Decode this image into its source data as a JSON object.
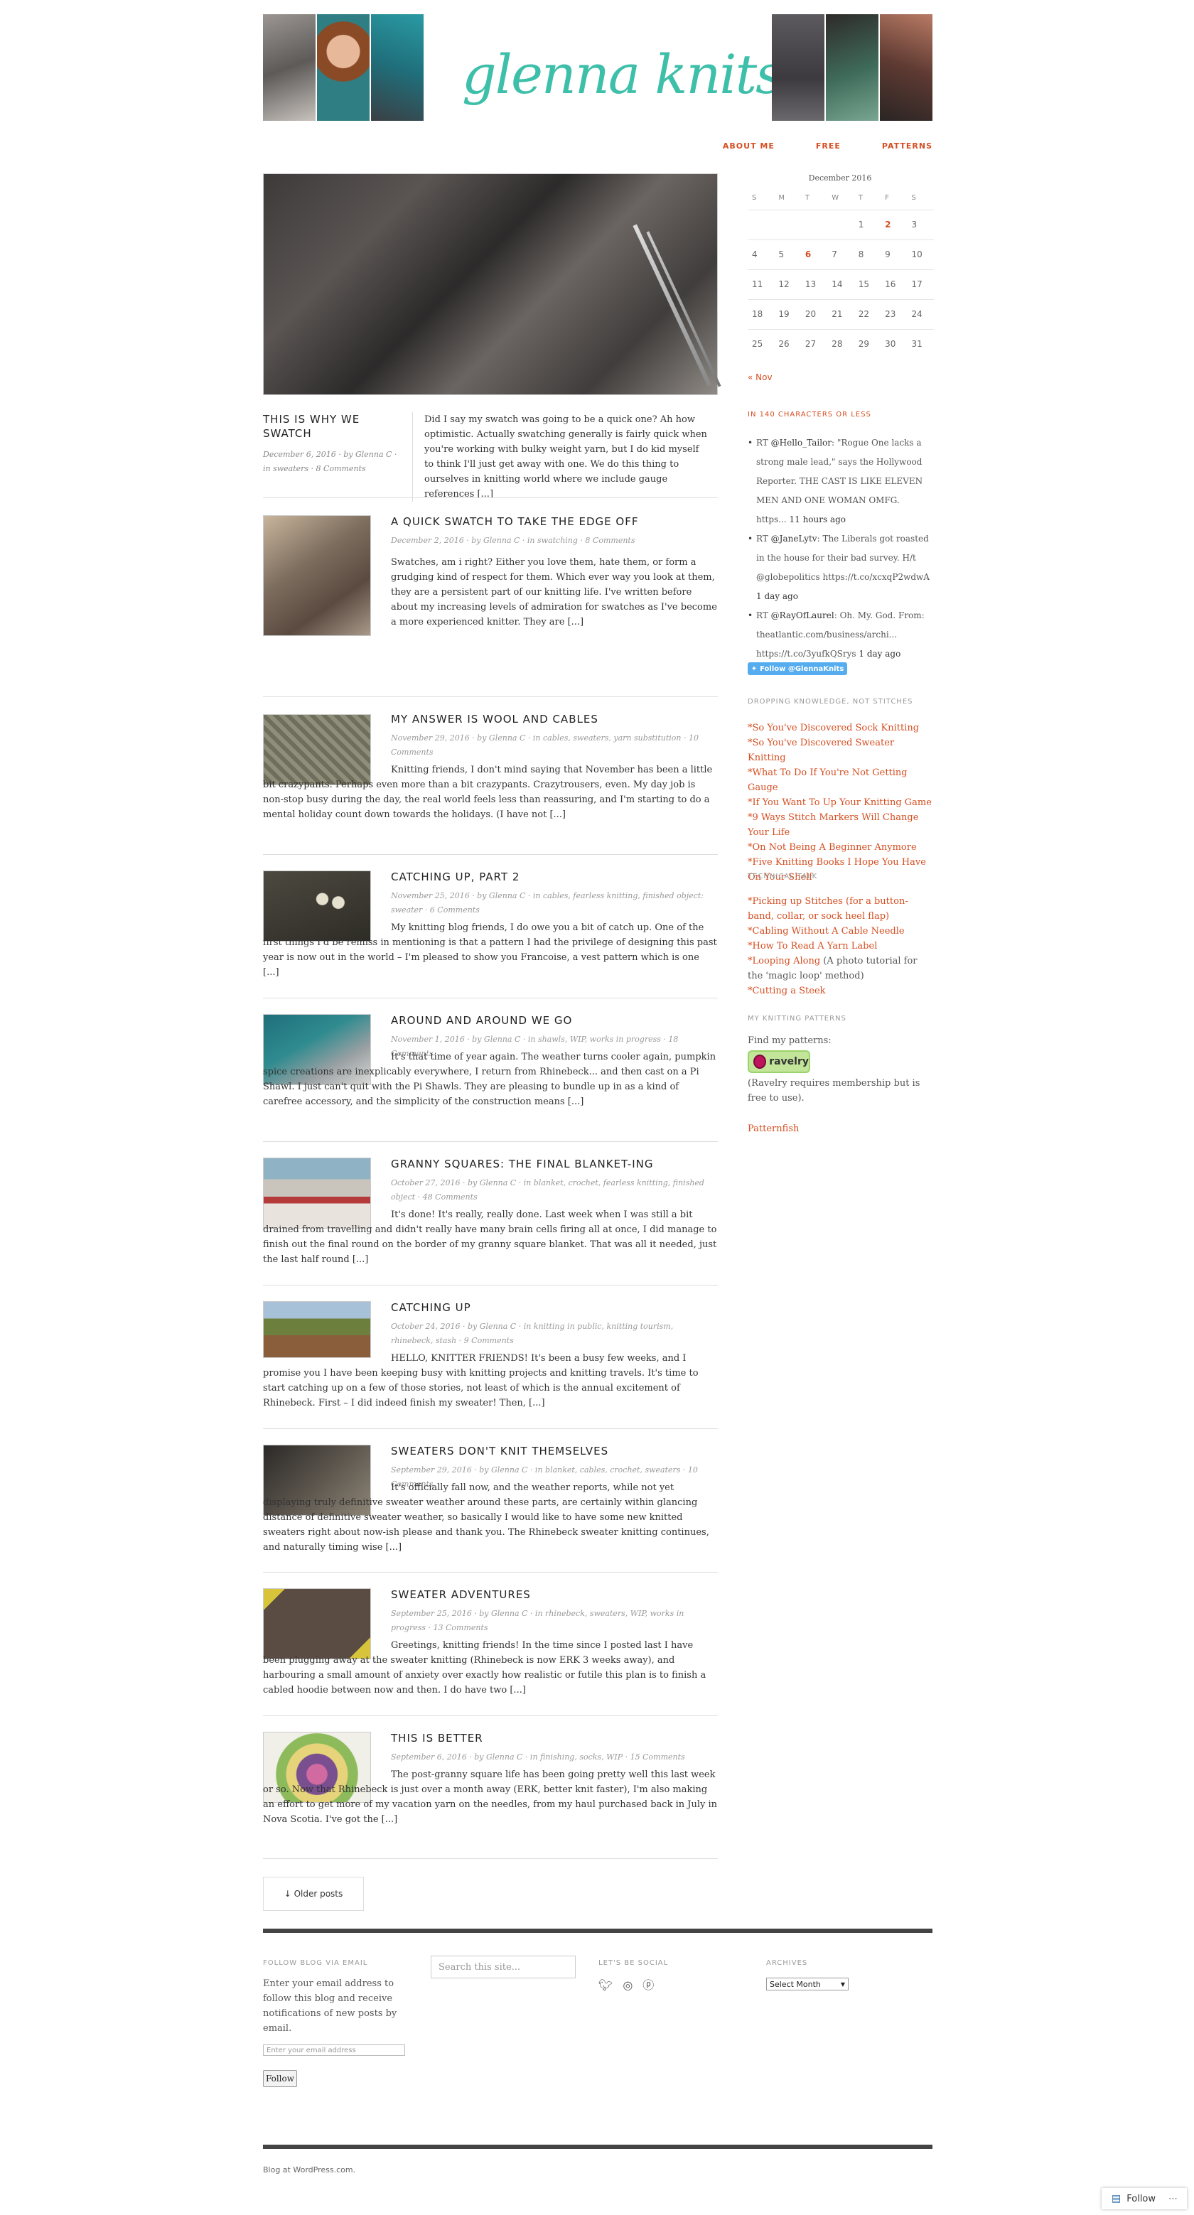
{
  "header": {
    "logo": "glenna knits"
  },
  "nav": [
    {
      "label": "ABOUT ME"
    },
    {
      "label": "FREE"
    },
    {
      "label": "PATTERNS"
    }
  ],
  "featured": {
    "title": "THIS IS WHY WE SWATCH",
    "meta": "December 6, 2016 · by Glenna C · in sweaters · 8 Comments",
    "excerpt": "Did I say my swatch was going to be a quick one? Ah how optimistic. Actually swatching generally is fairly quick when you're working with bulky weight yarn, but I do kid myself to think I'll just get away with one. We do this thing to ourselves in knitting world where we include gauge references [...]"
  },
  "posts": [
    {
      "title": "A QUICK SWATCH TO TAKE THE EDGE OFF",
      "meta": "December 2, 2016 · by Glenna C · in swatching · 8 Comments",
      "excerpt": "Swatches, am i right? Either you love them, hate them, or form a grudging kind of respect for them. Which ever way you look at them, they are a persistent part of our knitting life. I've written before about my increasing levels of admiration for swatches as I've become a more experienced knitter. They are [...]"
    },
    {
      "title": "MY ANSWER IS WOOL AND CABLES",
      "meta": "November 29, 2016 · by Glenna C · in cables, sweaters, yarn substitution · 10 Comments",
      "excerpt": "Knitting friends, I don't mind saying that November has been a little bit crazypants. Perhaps even more than a bit crazypants. Crazytrousers, even. My day job is non-stop busy during the day, the real world feels less than reassuring, and I'm starting to do a mental holiday count down towards the holidays. (I have not [...]"
    },
    {
      "title": "CATCHING UP, PART 2",
      "meta": "November 25, 2016 · by Glenna C · in cables, fearless knitting, finished object: sweater · 6 Comments",
      "excerpt": "My knitting blog friends, I do owe you a bit of catch up. One of the first things I'd be remiss in mentioning is that a pattern I had the privilege of designing this past year is now out in the world – I'm pleased to show you Francoise, a vest pattern which is one [...]"
    },
    {
      "title": "AROUND AND AROUND WE GO",
      "meta": "November 1, 2016 · by Glenna C · in shawls, WIP, works in progress · 18 Comments",
      "excerpt": "It's that time of year again. The weather turns cooler again, pumpkin spice creations are inexplicably everywhere, I return from Rhinebeck... and then cast on a Pi Shawl. I just can't quit with the Pi Shawls. They are pleasing to bundle up in as a kind of carefree accessory, and the simplicity of the construction means [...]"
    },
    {
      "title": "GRANNY SQUARES: THE FINAL BLANKET-ING",
      "meta": "October 27, 2016 · by Glenna C · in blanket, crochet, fearless knitting, finished object · 48 Comments",
      "excerpt": "It's done! It's really, really done. Last week when I was still a bit drained from travelling and didn't really have many brain cells firing all at once, I did manage to finish out the final round on the border of my granny square blanket. That was all it needed, just the last half round [...]"
    },
    {
      "title": "CATCHING UP",
      "meta": "October 24, 2016 · by Glenna C · in knitting in public, knitting tourism, rhinebeck, stash · 9 Comments",
      "excerpt": "HELLO, KNITTER FRIENDS! It's been a busy few weeks, and I promise you I have been keeping busy with knitting projects and knitting travels. It's time to start catching up on a few of those stories, not least of which is the annual excitement of Rhinebeck. First – I did indeed finish my sweater! Then, [...]"
    },
    {
      "title": "SWEATERS DON'T KNIT THEMSELVES",
      "meta": "September 29, 2016 · by Glenna C · in blanket, cables, crochet, sweaters · 10 Comments",
      "excerpt": "It's officially fall now, and the weather reports, while not yet displaying truly definitive sweater weather around these parts, are certainly within glancing distance of definitive sweater weather, so basically I would like to have some new knitted sweaters right about now-ish please and thank you. The Rhinebeck sweater knitting continues, and naturally timing wise [...]"
    },
    {
      "title": "SWEATER ADVENTURES",
      "meta": "September 25, 2016 · by Glenna C · in rhinebeck, sweaters, WIP, works in progress · 13 Comments",
      "excerpt": "Greetings, knitting friends! In the time since I posted last I have been plugging away at the sweater knitting (Rhinebeck is now ERK 3 weeks away), and harbouring a small amount of anxiety over exactly how realistic or futile this plan is to finish a cabled hoodie between now and then. I do have two [...]"
    },
    {
      "title": "THIS IS BETTER",
      "meta": "September 6, 2016 · by Glenna C · in finishing, socks, WIP · 15 Comments",
      "excerpt": "The post-granny square life has been going pretty well this last week or so. Now that Rhinebeck is just over a month away (ERK, better knit faster), I'm also making an effort to get more of my vacation yarn on the needles, from my haul purchased back in July in Nova Scotia. I've got the [...]"
    }
  ],
  "older_posts": "↓  Older posts",
  "calendar": {
    "caption": "December 2016",
    "days": [
      "S",
      "M",
      "T",
      "W",
      "T",
      "F",
      "S"
    ],
    "weeks": [
      [
        "",
        "",
        "",
        "",
        "1",
        "2",
        "3"
      ],
      [
        "4",
        "5",
        "6",
        "7",
        "8",
        "9",
        "10"
      ],
      [
        "11",
        "12",
        "13",
        "14",
        "15",
        "16",
        "17"
      ],
      [
        "18",
        "19",
        "20",
        "21",
        "22",
        "23",
        "24"
      ],
      [
        "25",
        "26",
        "27",
        "28",
        "29",
        "30",
        "31"
      ]
    ],
    "linked_days": [
      "2",
      "6"
    ],
    "prev": "« Nov"
  },
  "twitter": {
    "title": "IN 140 CHARACTERS OR LESS",
    "tweets": [
      {
        "prefix": "RT ",
        "handle": "@Hello_Tailor",
        "text": ": \"Rogue One lacks a strong male lead,\" says the Hollywood Reporter. THE CAST IS LIKE ELEVEN MEN AND ONE WOMAN OMFG. https...",
        "time": "11 hours ago"
      },
      {
        "prefix": "RT ",
        "handle": "@JaneLytv",
        "text": ": The Liberals got roasted in the house for their bad survey. H/t @globepolitics https://t.co/xcxqP2wdwA",
        "time": "1 day ago"
      },
      {
        "prefix": "RT ",
        "handle": "@RayOfLaurel",
        "text": ": Oh. My. God. From: theatlantic.com/business/archi... https://t.co/3yufkQSrys",
        "time": "1 day ago"
      }
    ],
    "follow": "Follow @GlennaKnits"
  },
  "dropping": {
    "title": "DROPPING KNOWLEDGE, NOT STITCHES",
    "links": [
      "*So You've Discovered Sock Knitting",
      "*So You've Discovered Sweater Knitting",
      "*What To Do If You're Not Getting Gauge",
      "*If You Want To Up Your Knitting Game",
      "*9 Ways Stitch Markers Will Change Your Life",
      "*On Not Being A Beginner Anymore",
      "*Five Knitting Books I Hope You Have On Your Shelf"
    ]
  },
  "technical": {
    "title": "TECHNICAL TALK",
    "items": [
      {
        "link": "*Picking up Stitches (for a button-band, collar, or sock heel flap)",
        "note": ""
      },
      {
        "link": "*Cabling Without A Cable Needle",
        "note": ""
      },
      {
        "link": "*How To Read A Yarn Label",
        "note": ""
      },
      {
        "link": "*Looping Along",
        "note": " (A photo tutorial for the 'magic loop' method)"
      },
      {
        "link": "*Cutting a Steek",
        "note": ""
      }
    ]
  },
  "patterns": {
    "title": "MY KNITTING PATTERNS",
    "find": "Find my patterns:",
    "ravelry": "ravelry",
    "note": "(Ravelry requires membership but is free to use).",
    "patternfish": "Patternfish"
  },
  "footer": {
    "email_title": "FOLLOW BLOG VIA EMAIL",
    "email_text": "Enter your email address to follow this blog and receive notifications of new posts by email.",
    "email_placeholder": "Enter your email address",
    "follow_button": "Follow",
    "search_placeholder": "Search this site...",
    "social_title": "LET'S BE SOCIAL",
    "archives_title": "ARCHIVES",
    "archives_select": "Select Month",
    "credit": "Blog at WordPress.com.",
    "wp_follow": "Follow"
  },
  "colors": {
    "accent": "#d54e21",
    "logo": "#3ebfa9",
    "twitter": "#55acee"
  }
}
